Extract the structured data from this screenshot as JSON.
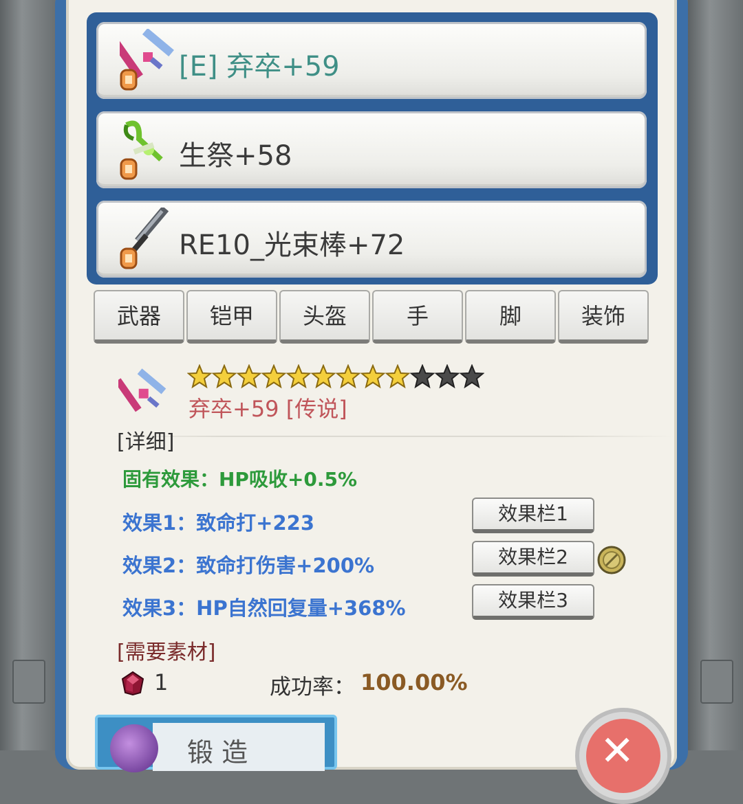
{
  "equipment_list": [
    {
      "name": "[E] 弃卒+59",
      "icon": "pink-sword-icon"
    },
    {
      "name": "生祭+58",
      "icon": "green-scythe-icon"
    },
    {
      "name": "RE10_光束棒+72",
      "icon": "dark-sword-icon"
    }
  ],
  "tabs": [
    "武器",
    "铠甲",
    "头盔",
    "手",
    "脚",
    "装饰"
  ],
  "selected_item": {
    "title": "弃卒+59 [传说]",
    "stars_filled": 9,
    "stars_total": 12,
    "detail_header": "[详细]",
    "inherent_effect": "固有效果：HP吸收+0.5%",
    "effects": [
      "效果1：致命打+223",
      "效果2：致命打伤害+200%",
      "效果3：HP自然回复量+368%"
    ],
    "slot_buttons": [
      "效果栏1",
      "效果栏2",
      "效果栏3"
    ]
  },
  "materials": {
    "header": "[需要素材]",
    "count": "1",
    "success_label": "成功率：",
    "success_rate": "100.00%"
  },
  "bottom": {
    "forge_label": "锻 造"
  },
  "colors": {
    "panel_border": "#3c6fa8",
    "item_title": "#c0555a",
    "inherent": "#2d9a3b",
    "effect": "#3b74d0",
    "success_rate": "#8a5a24"
  }
}
